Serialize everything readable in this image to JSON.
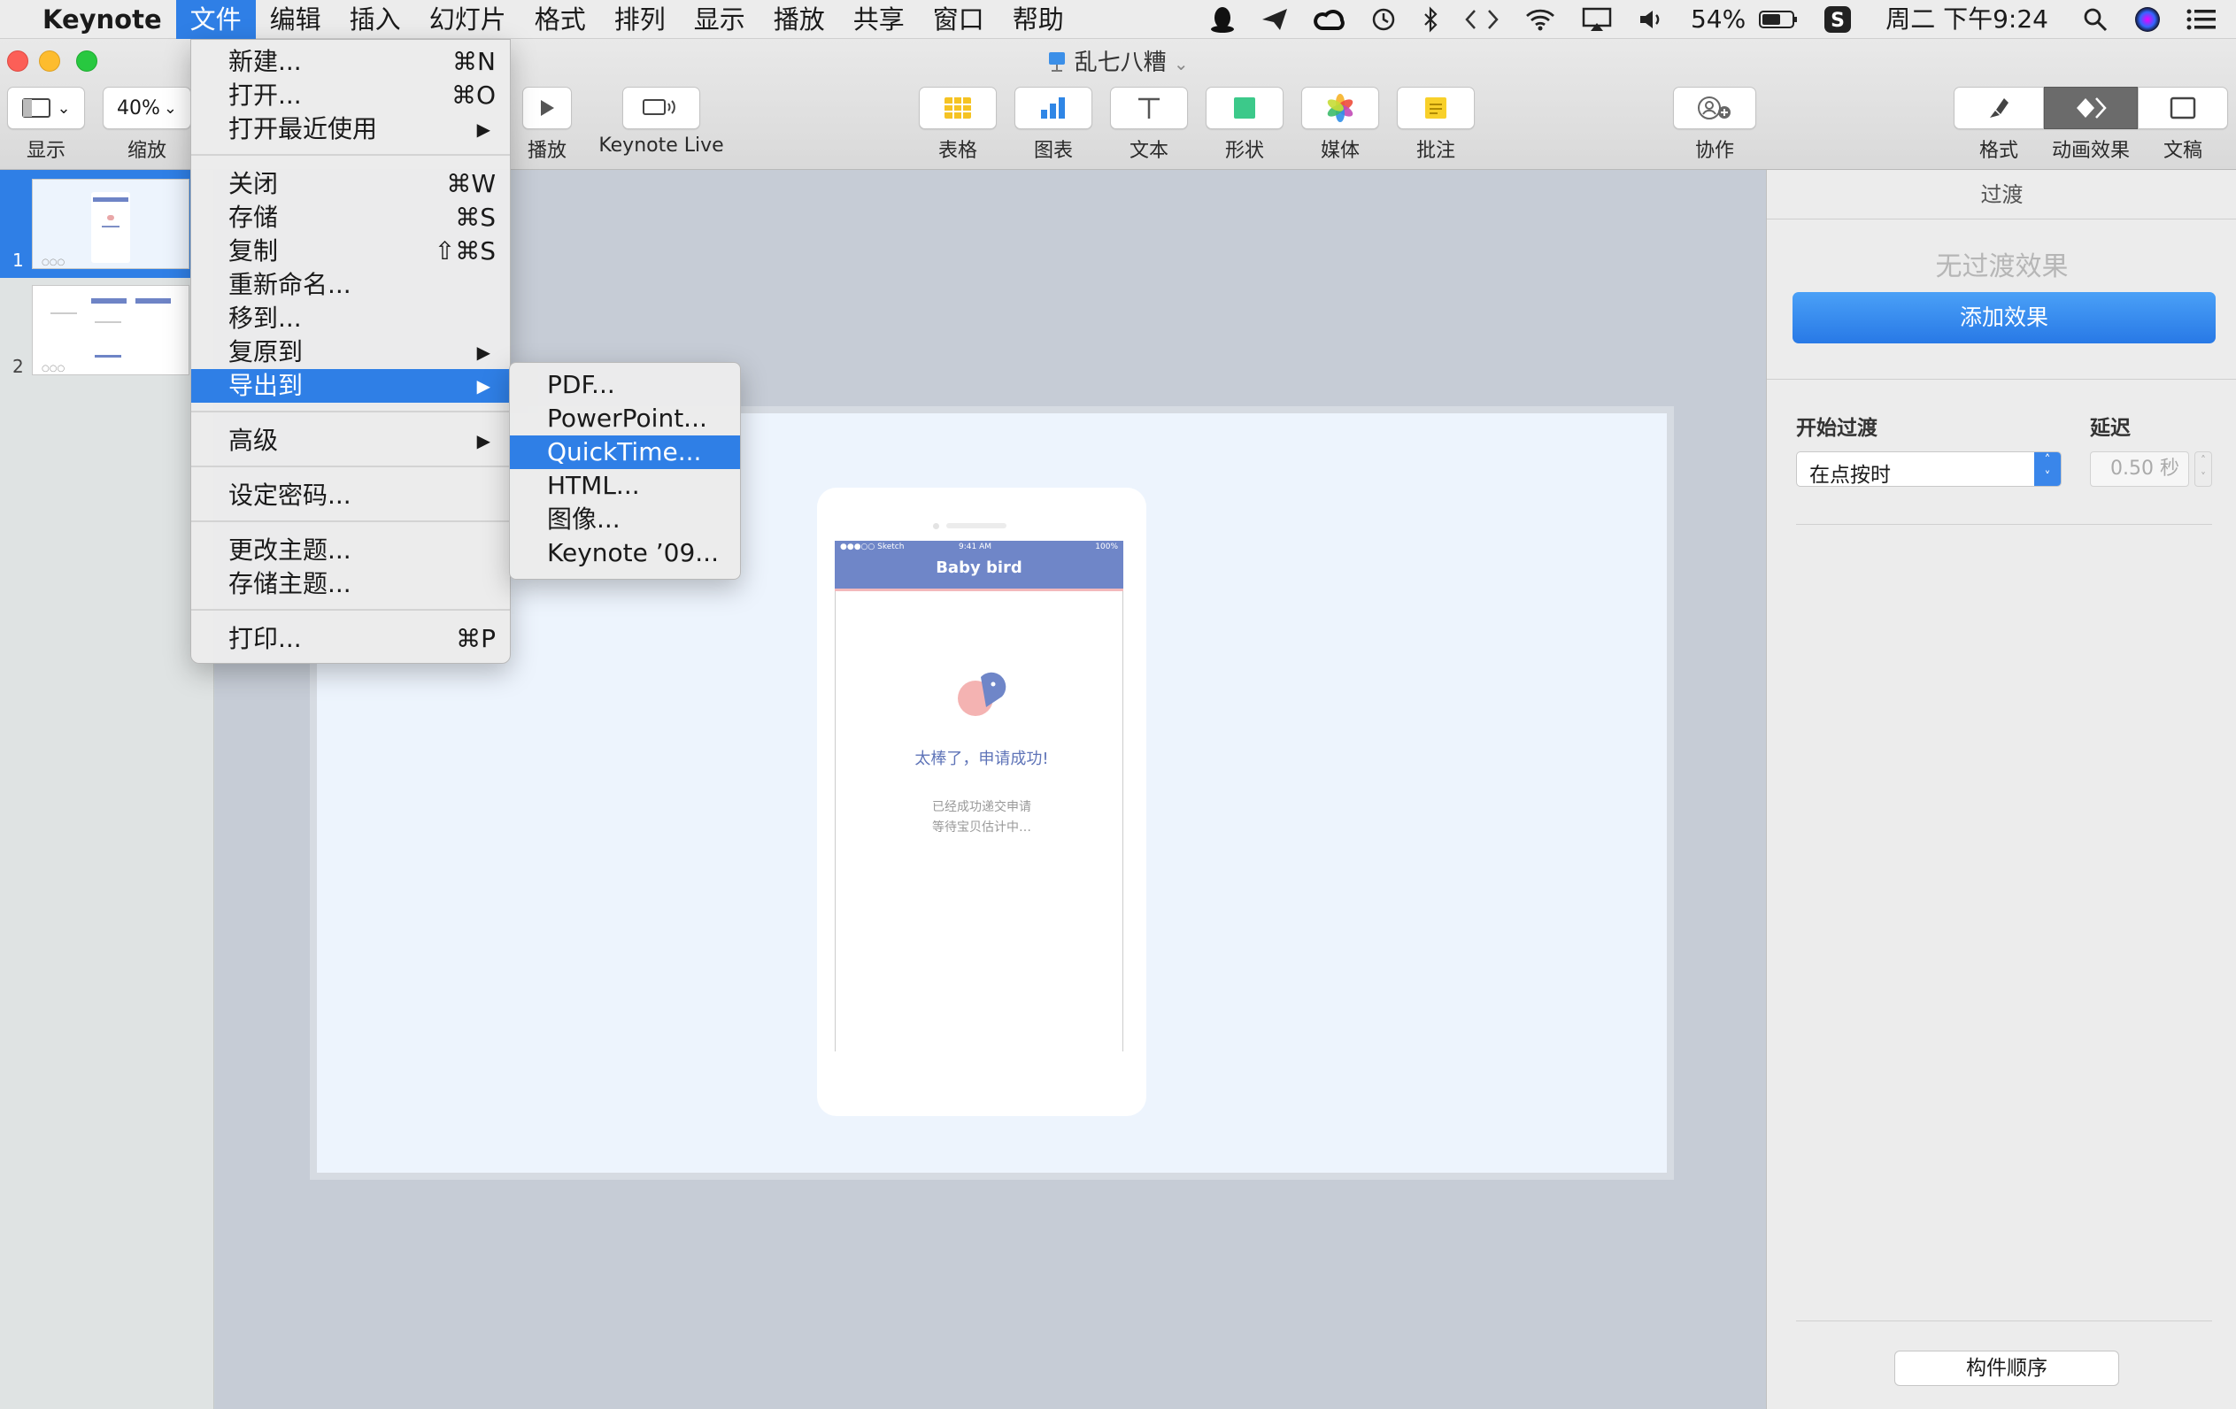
{
  "menubar": {
    "apple_glyph": "",
    "app_name": "Keynote",
    "menus": [
      "文件",
      "编辑",
      "插入",
      "幻灯片",
      "格式",
      "排列",
      "显示",
      "播放",
      "共享",
      "窗口",
      "帮助"
    ],
    "battery": "54%",
    "clock": "周二 下午9:24"
  },
  "window": {
    "doc_title": "乱七八糟",
    "zoom_value": "40%",
    "toolbar_labels": {
      "view": "显示",
      "zoom": "缩放",
      "play": "播放",
      "keynote_live": "Keynote Live",
      "table": "表格",
      "chart": "图表",
      "text": "文本",
      "shape": "形状",
      "media": "媒体",
      "comment": "批注",
      "collaborate": "协作",
      "format": "格式",
      "animate": "动画效果",
      "document": "文稿"
    }
  },
  "navigator": {
    "slides": [
      {
        "number": "1"
      },
      {
        "number": "2"
      }
    ]
  },
  "slide": {
    "status_left": "●●●○○ Sketch",
    "status_time": "9:41 AM",
    "status_battery": "100%",
    "app_title": "Baby bird",
    "success_title": "太棒了，申请成功!",
    "success_line1": "已经成功递交申请",
    "success_line2": "等待宝贝估计中…"
  },
  "inspector": {
    "tab_title": "过渡",
    "no_effect": "无过渡效果",
    "add_effect": "添加效果",
    "start_label": "开始过渡",
    "delay_label": "延迟",
    "start_value": "在点按时",
    "delay_value": "0.50 秒",
    "build_order": "构件顺序"
  },
  "file_menu": {
    "items": [
      {
        "label": "新建...",
        "shortcut": "⌘N"
      },
      {
        "label": "打开...",
        "shortcut": "⌘O"
      },
      {
        "label": "打开最近使用",
        "shortcut": "▶"
      },
      {
        "label": "关闭",
        "shortcut": "⌘W"
      },
      {
        "label": "存储",
        "shortcut": "⌘S"
      },
      {
        "label": "复制",
        "shortcut": "⇧⌘S"
      },
      {
        "label": "重新命名...",
        "shortcut": ""
      },
      {
        "label": "移到...",
        "shortcut": ""
      },
      {
        "label": "复原到",
        "shortcut": "▶"
      },
      {
        "label": "导出到",
        "shortcut": "▶"
      },
      {
        "label": "高级",
        "shortcut": "▶"
      },
      {
        "label": "设定密码...",
        "shortcut": ""
      },
      {
        "label": "更改主题...",
        "shortcut": ""
      },
      {
        "label": "存储主题...",
        "shortcut": ""
      },
      {
        "label": "打印...",
        "shortcut": "⌘P"
      }
    ]
  },
  "export_menu": {
    "items": [
      "PDF...",
      "PowerPoint...",
      "QuickTime...",
      "HTML...",
      "图像...",
      "Keynote ’09..."
    ]
  }
}
